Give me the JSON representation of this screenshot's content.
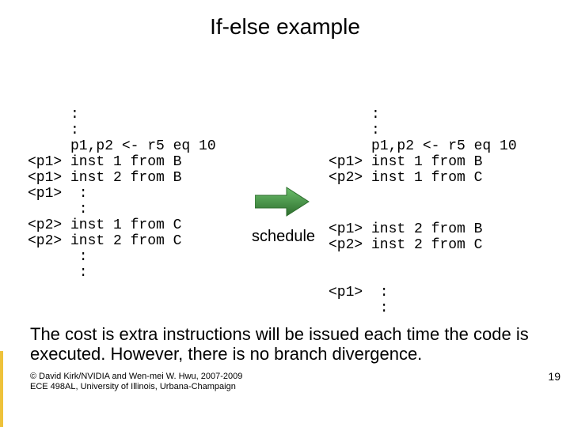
{
  "title": "If-else example",
  "leftCode": "     :\n     :\n     p1,p2 <- r5 eq 10\n<p1> inst 1 from B\n<p1> inst 2 from B\n<p1>  :\n      :\n<p2> inst 1 from C\n<p2> inst 2 from C\n      :\n      :",
  "rightCode1": "     :\n     :\n     p1,p2 <- r5 eq 10\n<p1> inst 1 from B\n<p2> inst 1 from C",
  "rightCode2": "<p1> inst 2 from B\n<p2> inst 2 from C",
  "rightCode3": "<p1>  :\n      :",
  "scheduleLabel": "schedule",
  "conclusion": "The cost is extra instructions will be issued each time the code is executed. However, there is no branch divergence.",
  "credit": "© David Kirk/NVIDIA and Wen-mei W. Hwu, 2007-2009\nECE 498AL, University of Illinois, Urbana-Champaign",
  "pageNumber": "19",
  "arrowColor": "#3d8b3d"
}
